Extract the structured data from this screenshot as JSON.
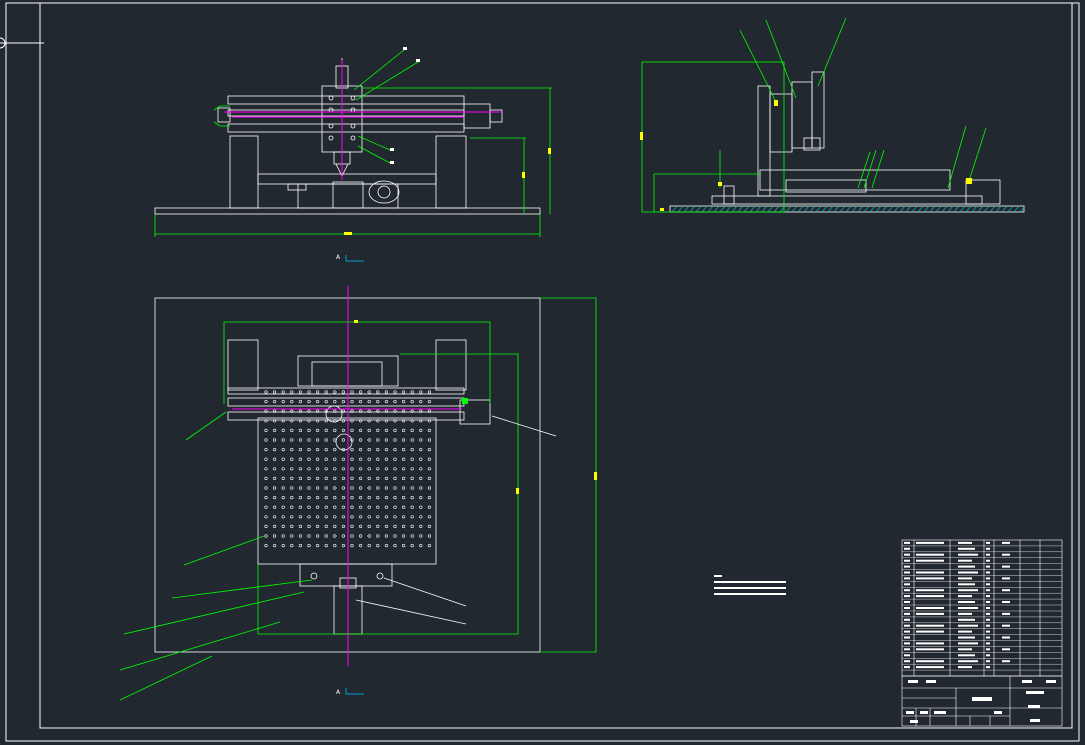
{
  "drawing": {
    "background": "#212830",
    "colors": {
      "outline": "#ffffff",
      "dimension": "#00ff00",
      "center_line": "#ff00ff",
      "leader": "#00ff00",
      "highlight": "#ffff00",
      "hatch": "#00c0c0"
    },
    "views": [
      "front-view",
      "side-view",
      "top-view"
    ],
    "section_marks": [
      "A",
      "A"
    ],
    "notes": {
      "line_count": 4
    },
    "parts_list": {
      "row_count": 22
    },
    "title_block": {}
  }
}
